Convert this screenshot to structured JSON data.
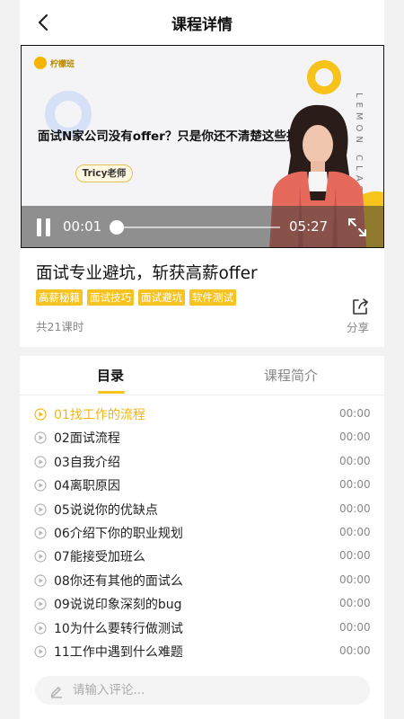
{
  "nav": {
    "title": "课程详情",
    "back_icon": "chevron-left-icon"
  },
  "video": {
    "brand_text": "柠檬班",
    "headline": "面试N家公司没有offer？只是你还不清楚这些技巧而已",
    "teacher": "Tricy老师",
    "vertical_text": "LEMON CLASS",
    "current_time": "00:01",
    "total_time": "05:27",
    "progress": 0.003,
    "playing": true
  },
  "course": {
    "title": "面试专业避坑，斩获高薪offer",
    "tags": [
      "高薪秘籍",
      "面试技巧",
      "面试避坑",
      "软件测试"
    ],
    "lessons_count": "共21课时",
    "share_label": "分享"
  },
  "tabs": [
    {
      "label": "目录",
      "active": true
    },
    {
      "label": "课程简介",
      "active": false
    }
  ],
  "lessons": [
    {
      "name": "01找工作的流程",
      "duration": "00:00",
      "active": true
    },
    {
      "name": "02面试流程",
      "duration": "00:00",
      "active": false
    },
    {
      "name": "03自我介绍",
      "duration": "00:00",
      "active": false
    },
    {
      "name": "04离职原因",
      "duration": "00:00",
      "active": false
    },
    {
      "name": "05说说你的优缺点",
      "duration": "00:00",
      "active": false
    },
    {
      "name": "06介绍下你的职业规划",
      "duration": "00:00",
      "active": false
    },
    {
      "name": "07能接受加班么",
      "duration": "00:00",
      "active": false
    },
    {
      "name": "08你还有其他的面试么",
      "duration": "00:00",
      "active": false
    },
    {
      "name": "09说说印象深刻的bug",
      "duration": "00:00",
      "active": false
    },
    {
      "name": "10为什么要转行做测试",
      "duration": "00:00",
      "active": false
    },
    {
      "name": "11工作中遇到什么难题",
      "duration": "00:00",
      "active": false
    }
  ],
  "comment": {
    "placeholder": "请输入评论...",
    "value": ""
  },
  "colors": {
    "accent": "#f7c321",
    "active_text": "#f2b614",
    "muted": "#888888"
  }
}
